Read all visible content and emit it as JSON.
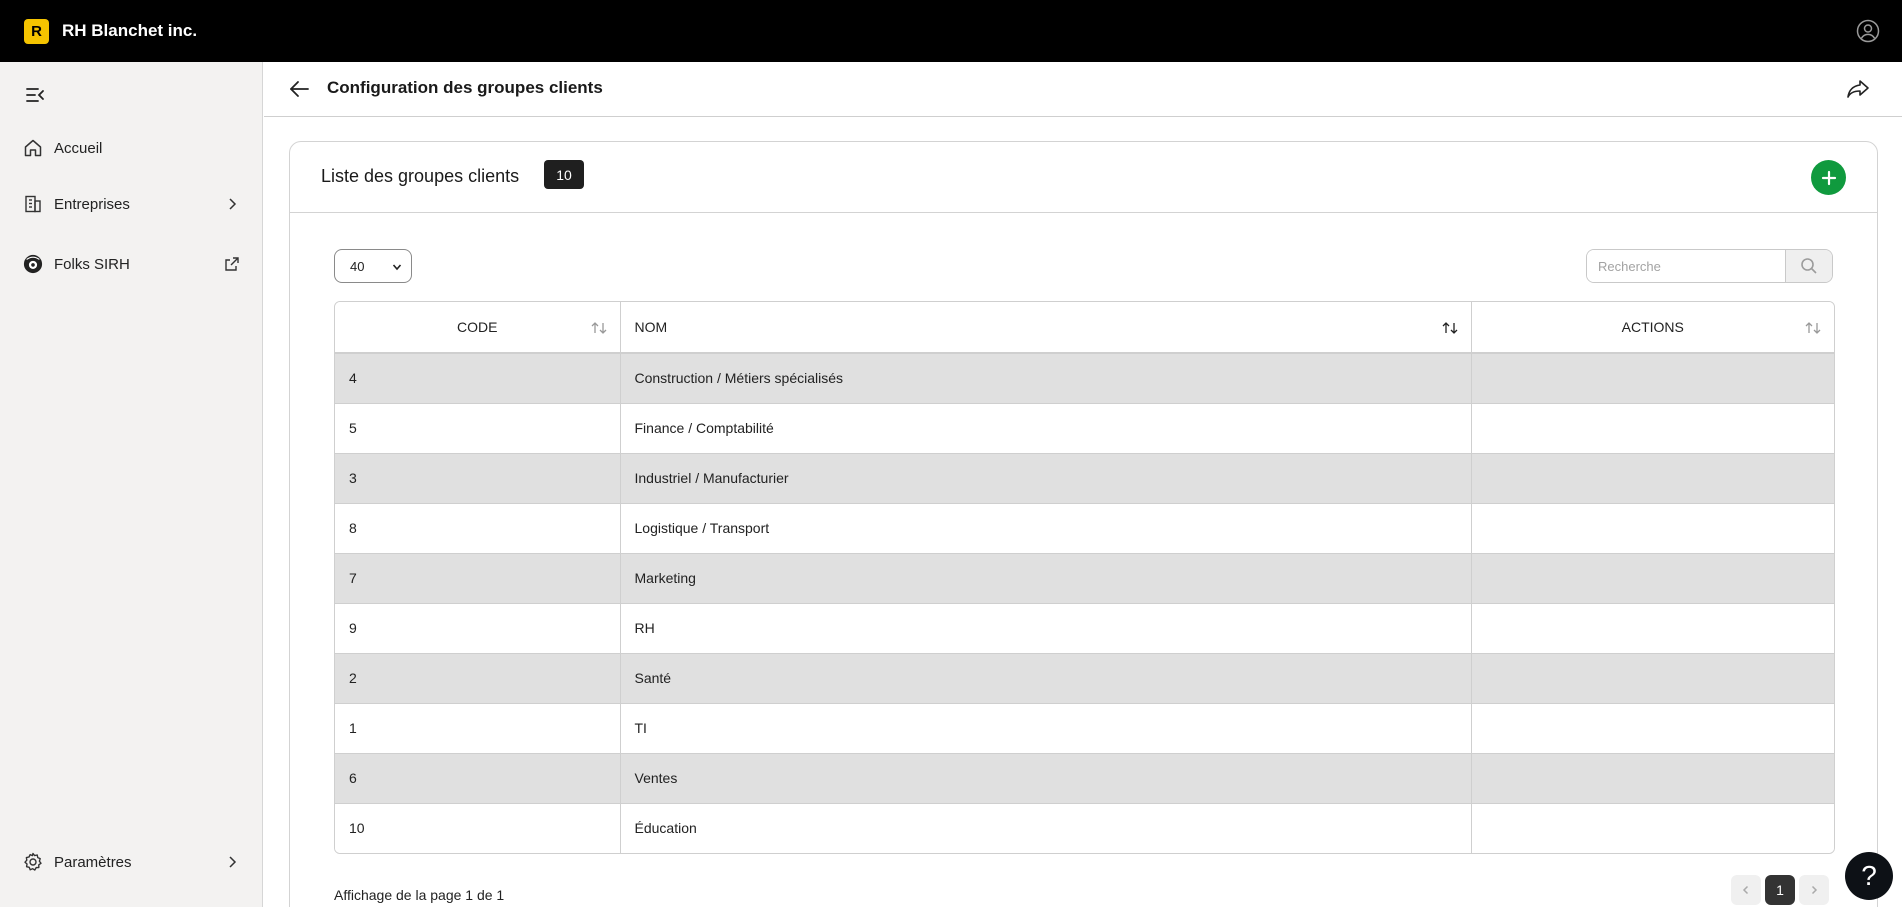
{
  "app": {
    "logo_letter": "R",
    "company_name": "RH Blanchet inc."
  },
  "sidebar": {
    "items": [
      {
        "label": "Accueil"
      },
      {
        "label": "Entreprises"
      },
      {
        "label": "Folks SIRH"
      }
    ],
    "settings_label": "Paramètres"
  },
  "header": {
    "title": "Configuration des groupes clients"
  },
  "card": {
    "title": "Liste des groupes clients",
    "count": "10",
    "per_page": "40",
    "search_placeholder": "Recherche"
  },
  "table": {
    "headers": {
      "code": "CODE",
      "nom": "NOM",
      "actions": "ACTIONS"
    },
    "rows": [
      {
        "code": "4",
        "nom": "Construction / Métiers spécialisés",
        "actions": ""
      },
      {
        "code": "5",
        "nom": "Finance / Comptabilité",
        "actions": ""
      },
      {
        "code": "3",
        "nom": "Industriel / Manufacturier",
        "actions": ""
      },
      {
        "code": "8",
        "nom": "Logistique / Transport",
        "actions": ""
      },
      {
        "code": "7",
        "nom": "Marketing",
        "actions": ""
      },
      {
        "code": "9",
        "nom": "RH",
        "actions": ""
      },
      {
        "code": "2",
        "nom": "Santé",
        "actions": ""
      },
      {
        "code": "1",
        "nom": "TI",
        "actions": ""
      },
      {
        "code": "6",
        "nom": "Ventes",
        "actions": ""
      },
      {
        "code": "10",
        "nom": "Éducation",
        "actions": ""
      }
    ]
  },
  "footer": {
    "page_info": "Affichage de la page 1 de 1",
    "current_page": "1"
  },
  "help": {
    "label": "?"
  },
  "colors": {
    "brand": "#f5c400",
    "add_button": "#109a3e",
    "topbar": "#000000"
  }
}
